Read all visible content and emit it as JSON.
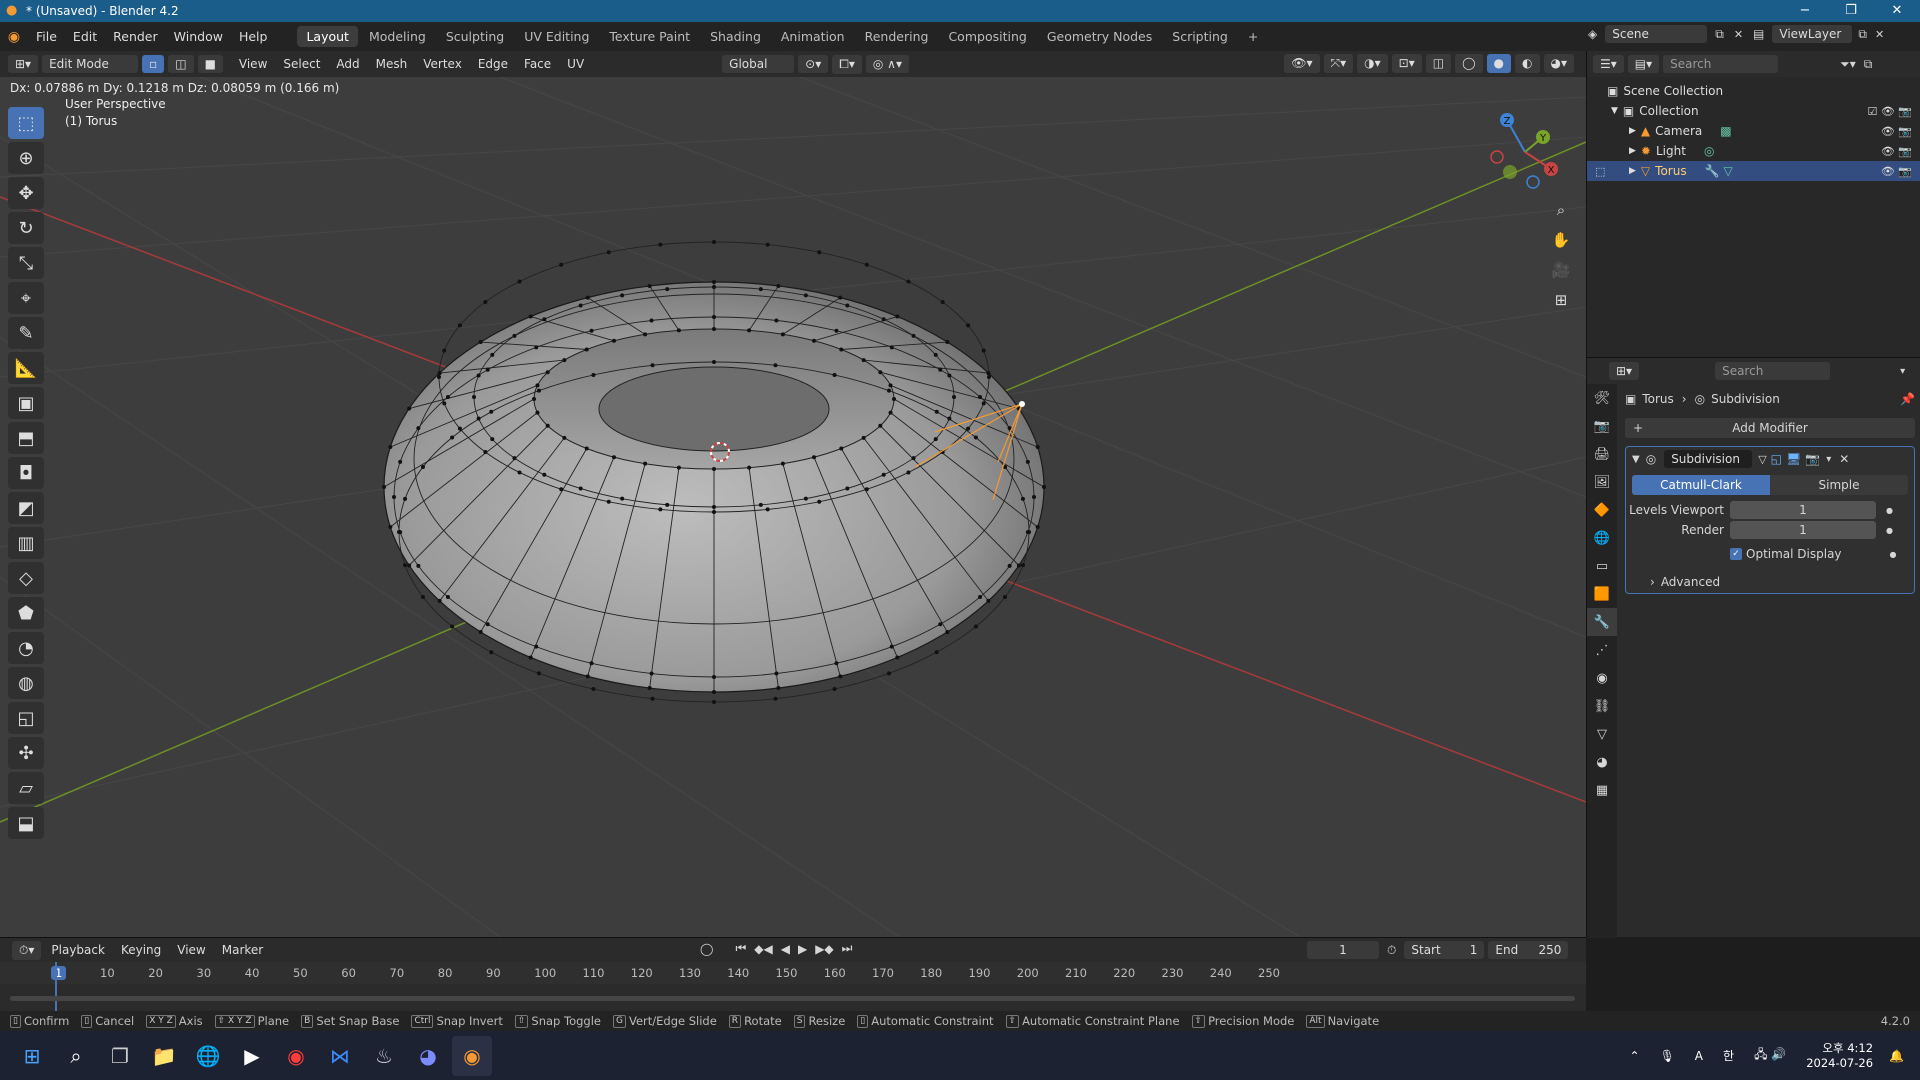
{
  "window": {
    "title": "* (Unsaved) - Blender 4.2",
    "minimize": "−",
    "maximize": "❐",
    "close": "✕"
  },
  "menus": [
    "File",
    "Edit",
    "Render",
    "Window",
    "Help"
  ],
  "workspaces": [
    "Layout",
    "Modeling",
    "Sculpting",
    "UV Editing",
    "Texture Paint",
    "Shading",
    "Animation",
    "Rendering",
    "Compositing",
    "Geometry Nodes",
    "Scripting"
  ],
  "active_workspace": "Layout",
  "scene": {
    "label": "Scene",
    "view_layer": "ViewLayer"
  },
  "viewport_header": {
    "mode": "Edit Mode",
    "menus": [
      "View",
      "Select",
      "Add",
      "Mesh",
      "Vertex",
      "Edge",
      "Face",
      "UV"
    ],
    "orientation": "Global"
  },
  "viewport": {
    "transform_info": "Dx: 0.07886 m   Dy: 0.1218 m   Dz: 0.08059 m (0.166 m)",
    "perspective": "User Perspective",
    "object": "(1) Torus",
    "gizmo": {
      "x": "X",
      "y": "Y",
      "z": "Z"
    }
  },
  "outliner": {
    "search_placeholder": "Search",
    "root": "Scene Collection",
    "collection": "Collection",
    "items": [
      {
        "name": "Camera",
        "icon": "camera-icon"
      },
      {
        "name": "Light",
        "icon": "light-icon"
      },
      {
        "name": "Torus",
        "icon": "mesh-icon",
        "selected": true
      }
    ]
  },
  "properties": {
    "search_placeholder": "Search",
    "breadcrumb_object": "Torus",
    "breadcrumb_modifier": "Subdivision",
    "add_modifier": "Add Modifier",
    "modifier_name": "Subdivision",
    "algo_options": [
      "Catmull-Clark",
      "Simple"
    ],
    "algo_active": "Catmull-Clark",
    "levels_viewport_label": "Levels Viewport",
    "levels_viewport": "1",
    "render_label": "Render",
    "render": "1",
    "optimal_display": "Optimal Display",
    "advanced": "Advanced"
  },
  "timeline": {
    "menus": [
      "Playback",
      "Keying",
      "View",
      "Marker"
    ],
    "current_frame": "1",
    "start_label": "Start",
    "start": "1",
    "end_label": "End",
    "end": "250",
    "ruler": [
      "1",
      "10",
      "20",
      "30",
      "40",
      "50",
      "60",
      "70",
      "80",
      "90",
      "100",
      "110",
      "120",
      "130",
      "140",
      "150",
      "160",
      "170",
      "180",
      "190",
      "200",
      "210",
      "220",
      "230",
      "240",
      "250"
    ]
  },
  "statusbar": {
    "items": [
      {
        "key": "",
        "label": "Confirm"
      },
      {
        "key": "",
        "label": "Cancel"
      },
      {
        "key": "X Y Z",
        "label": "Axis"
      },
      {
        "key": "⇧ X Y Z",
        "label": "Plane"
      },
      {
        "key": "B",
        "label": "Set Snap Base"
      },
      {
        "key": "Ctrl",
        "label": "Snap Invert"
      },
      {
        "key": "⇧",
        "label": "Snap Toggle"
      },
      {
        "key": "G",
        "label": "Vert/Edge Slide"
      },
      {
        "key": "R",
        "label": "Rotate"
      },
      {
        "key": "S",
        "label": "Resize"
      },
      {
        "key": "",
        "label": "Automatic Constraint"
      },
      {
        "key": "⇧",
        "label": "Automatic Constraint Plane"
      },
      {
        "key": "⇧",
        "label": "Precision Mode"
      },
      {
        "key": "Alt",
        "label": "Navigate"
      }
    ],
    "version": "4.2.0"
  },
  "taskbar": {
    "time": "오후 4:12",
    "date": "2024-07-26",
    "ime": "A",
    "ime2": "한"
  },
  "colors": {
    "accent": "#4772b3",
    "titlebar": "#1a5c8a",
    "x_axis": "#c84343",
    "y_axis": "#7aa32a",
    "z_axis": "#3d83d6",
    "selection_orange": "#f59a33"
  }
}
